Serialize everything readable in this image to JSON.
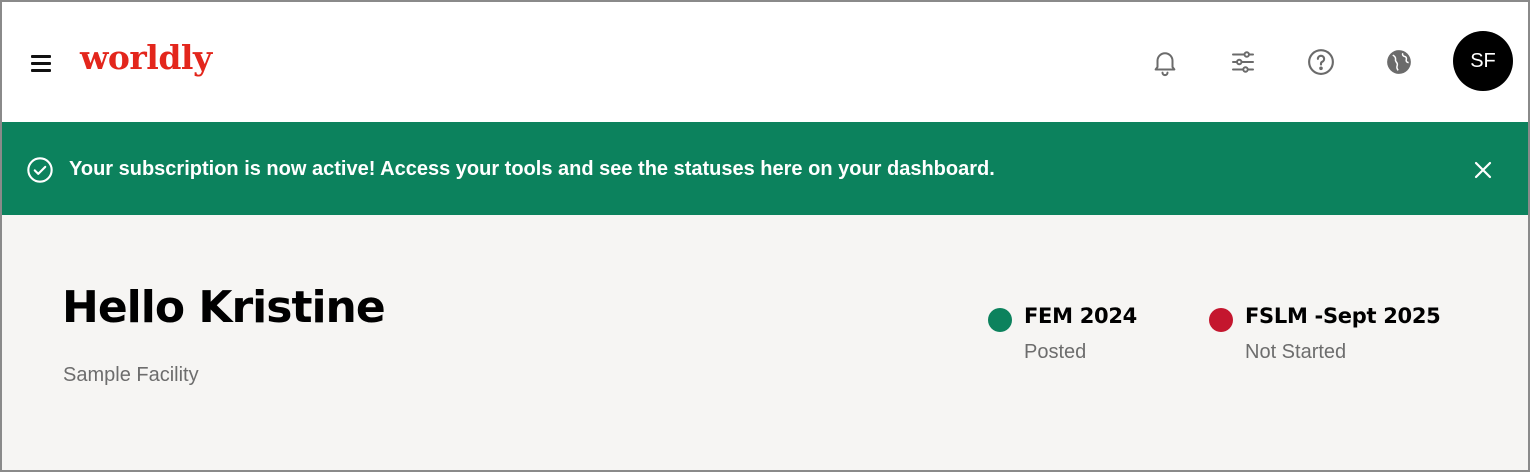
{
  "header": {
    "logo_text": "worldly",
    "brand_color": "#e3261c",
    "icons": [
      "menu-icon",
      "bell-icon",
      "sliders-icon",
      "help-circle-icon",
      "globe-icon"
    ],
    "avatar_initials": "SF"
  },
  "banner": {
    "message": "Your subscription is now active! Access your tools and see the statuses here on your dashboard.",
    "background_color": "#0c825d",
    "icons": [
      "check-circle-icon",
      "close-icon"
    ]
  },
  "main": {
    "greeting": "Hello Kristine",
    "facility": "Sample Facility",
    "statuses": [
      {
        "title": "FEM 2024",
        "state": "Posted",
        "color": "#0c825d"
      },
      {
        "title": "FSLM -Sept 2025",
        "state": "Not Started",
        "color": "#c4162e"
      }
    ]
  }
}
